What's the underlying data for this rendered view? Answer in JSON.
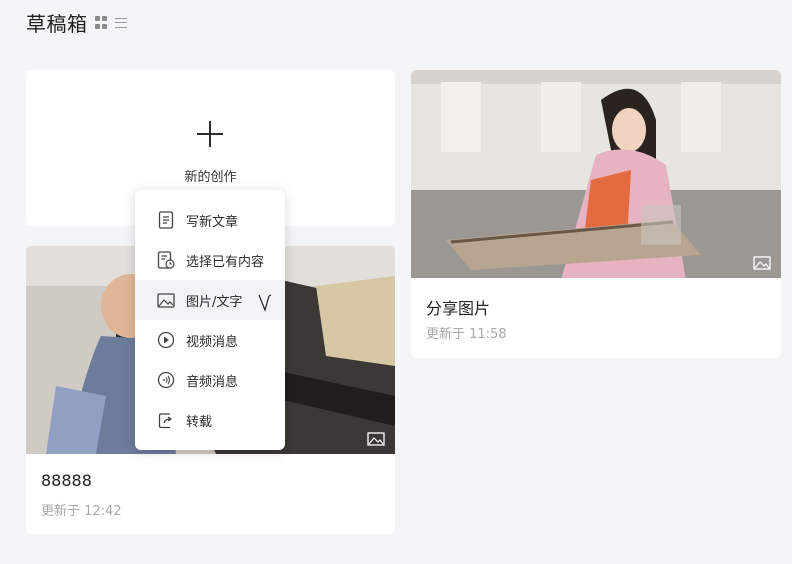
{
  "header": {
    "title": "草稿箱"
  },
  "new_card": {
    "label": "新的创作"
  },
  "drafts": [
    {
      "title": "88888",
      "updated": "更新于 12:42"
    },
    {
      "title": "分享图片",
      "updated": "更新于 11:58"
    }
  ],
  "menu": {
    "items": [
      {
        "label": "写新文章",
        "icon": "document-icon"
      },
      {
        "label": "选择已有内容",
        "icon": "document-clock-icon"
      },
      {
        "label": "图片/文字",
        "icon": "image-icon"
      },
      {
        "label": "视频消息",
        "icon": "play-circle-icon"
      },
      {
        "label": "音频消息",
        "icon": "audio-circle-icon"
      },
      {
        "label": "转载",
        "icon": "share-icon"
      }
    ],
    "hovered_index": 2
  },
  "colors": {
    "page_bg": "#f4f5f7",
    "card_bg": "#ffffff",
    "menu_hover": "#f2f3f5",
    "muted_text": "#a8a8a8"
  }
}
